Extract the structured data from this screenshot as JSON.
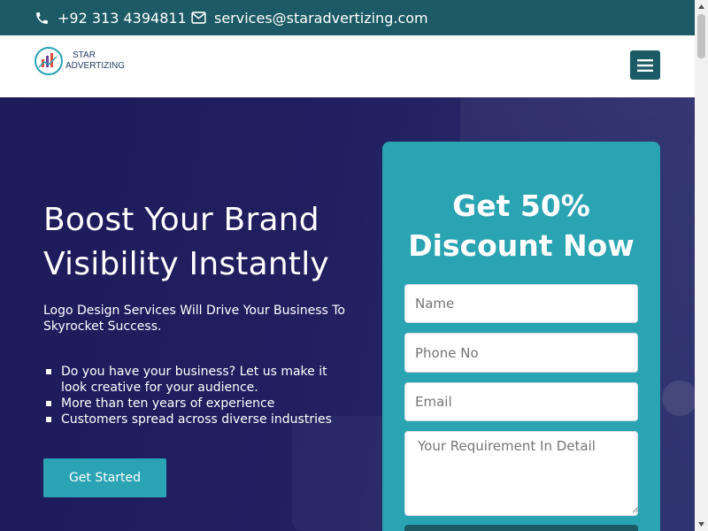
{
  "topbar": {
    "phone": "+92 313 4394811",
    "email": "services@staradvertizing.com",
    "phone_icon": "phone-icon",
    "email_icon": "envelope-icon"
  },
  "header": {
    "logo_line1": "STAR",
    "logo_line2": "ADVERTIZING",
    "menu_icon": "hamburger-icon"
  },
  "hero": {
    "title": "Boost Your Brand Visibility Instantly",
    "subtitle": "Logo Design Services Will Drive Your Business To Skyrocket Success.",
    "bullets": [
      "Do you have your business? Let us make it look creative for your audience.",
      "More than ten years of experience",
      "Customers spread across diverse industries"
    ],
    "cta_label": "Get Started"
  },
  "form": {
    "title": "Get 50% Discount Now",
    "name_placeholder": "Name",
    "phone_placeholder": "Phone No",
    "email_placeholder": "Email",
    "requirement_placeholder": "Your Requirement In Detail"
  },
  "colors": {
    "topbar": "#1c5b66",
    "hero_bg": "#211f60",
    "form_bg": "#2aa3b2",
    "cta": "#2aa3b5",
    "text_light": "#ffffff"
  }
}
